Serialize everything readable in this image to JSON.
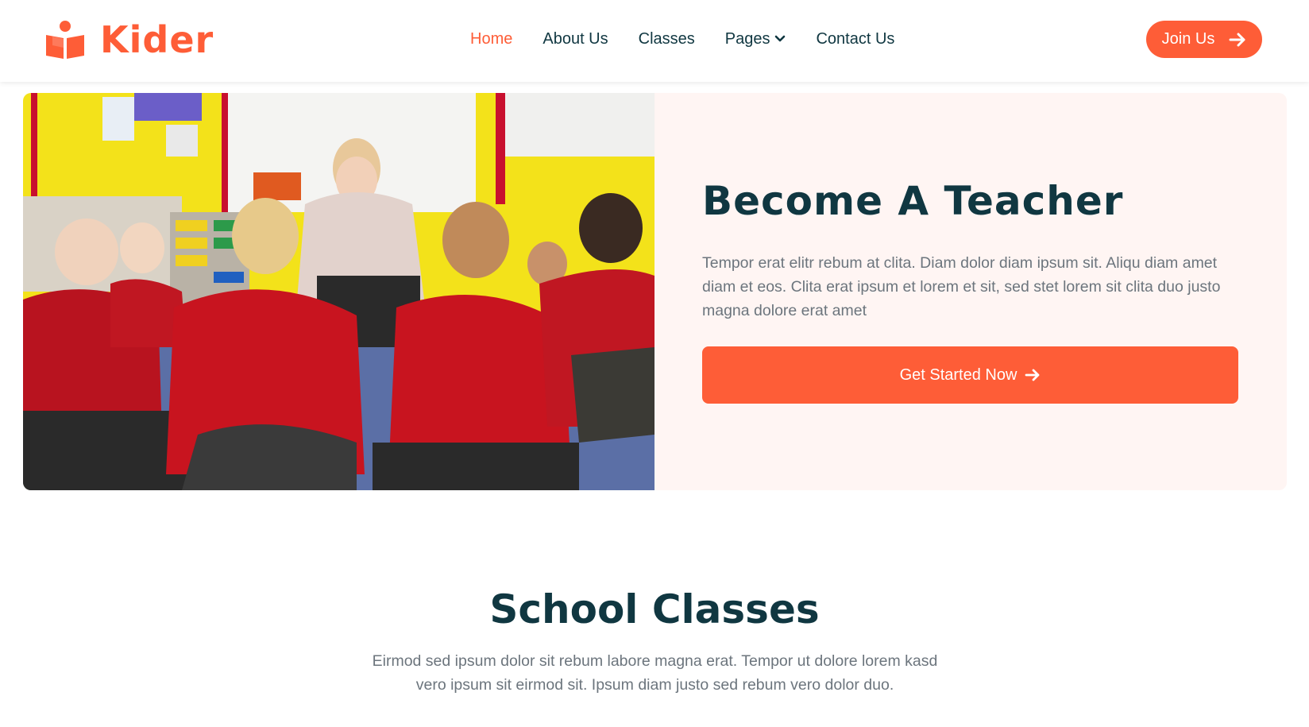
{
  "brand": {
    "name": "Kider",
    "logo_icon": "book-reader-icon",
    "color": "#FE5D37"
  },
  "nav": {
    "items": [
      {
        "label": "Home",
        "active": true
      },
      {
        "label": "About Us",
        "active": false
      },
      {
        "label": "Classes",
        "active": false
      },
      {
        "label": "Pages",
        "active": false,
        "dropdown_icon": "chevron-down-icon"
      },
      {
        "label": "Contact Us",
        "active": false
      }
    ],
    "join_label": "Join Us",
    "join_icon": "arrow-right-icon"
  },
  "hero": {
    "image_alt": "classroom-teacher-with-children-image",
    "title": "Become A Teacher",
    "text": "Tempor erat elitr rebum at clita. Diam dolor diam ipsum sit. Aliqu diam amet diam et eos. Clita erat ipsum et lorem et sit, sed stet lorem sit clita duo justo magna dolore erat amet",
    "cta_label": "Get Started Now",
    "cta_icon": "arrow-right-icon"
  },
  "classes_section": {
    "title": "School Classes",
    "text": "Eirmod sed ipsum dolor sit rebum labore magna erat. Tempor ut dolore lorem kasd vero ipsum sit eirmod sit. Ipsum diam justo sed rebum vero dolor duo."
  },
  "colors": {
    "primary": "#FE5D37",
    "dark": "#103741",
    "light_panel": "#FFF5F3",
    "muted_text": "#6c757d"
  }
}
